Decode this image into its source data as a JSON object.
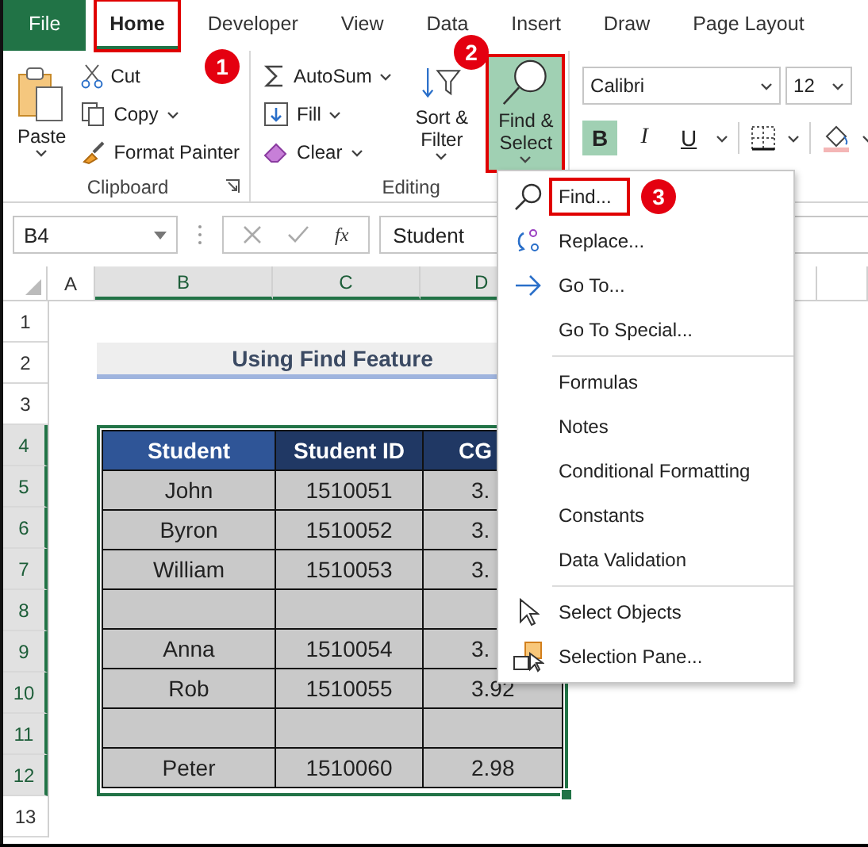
{
  "tabs": [
    {
      "label": "File",
      "kind": "file",
      "selected": false,
      "highlighted": false
    },
    {
      "label": "Home",
      "kind": "tab",
      "selected": true,
      "highlighted": true
    },
    {
      "label": "Developer",
      "kind": "tab",
      "selected": false,
      "highlighted": false
    },
    {
      "label": "View",
      "kind": "tab",
      "selected": false,
      "highlighted": false
    },
    {
      "label": "Data",
      "kind": "tab",
      "selected": false,
      "highlighted": false
    },
    {
      "label": "Insert",
      "kind": "tab",
      "selected": false,
      "highlighted": false
    },
    {
      "label": "Draw",
      "kind": "tab",
      "selected": false,
      "highlighted": false
    },
    {
      "label": "Page Layout",
      "kind": "tab",
      "selected": false,
      "highlighted": false
    }
  ],
  "ribbon": {
    "clipboard": {
      "label": "Clipboard",
      "paste": "Paste",
      "cut": "Cut",
      "copy": "Copy",
      "format_painter": "Format Painter"
    },
    "editing": {
      "label": "Editing",
      "autosum": "AutoSum",
      "fill": "Fill",
      "clear": "Clear",
      "sort_filter": "Sort & Filter",
      "find_select": {
        "label": "Find & Select",
        "selected": true,
        "highlighted": true
      }
    },
    "font": {
      "font_name": "Calibri",
      "font_size": "12",
      "bold": {
        "label": "B",
        "on": true
      },
      "italic": {
        "label": "I",
        "on": false
      },
      "underline": {
        "label": "U",
        "on": false
      }
    }
  },
  "formula_bar": {
    "name_box": "B4",
    "function_label": "fx",
    "value": "Student"
  },
  "sheet": {
    "columns": [
      {
        "label": "A",
        "selected": false
      },
      {
        "label": "B",
        "selected": true
      },
      {
        "label": "C",
        "selected": true
      },
      {
        "label": "D",
        "selected": true
      }
    ],
    "rows": [
      {
        "label": "1",
        "selected": false
      },
      {
        "label": "2",
        "selected": false
      },
      {
        "label": "3",
        "selected": false
      },
      {
        "label": "4",
        "selected": true
      },
      {
        "label": "5",
        "selected": true
      },
      {
        "label": "6",
        "selected": true
      },
      {
        "label": "7",
        "selected": true
      },
      {
        "label": "8",
        "selected": true
      },
      {
        "label": "9",
        "selected": true
      },
      {
        "label": "10",
        "selected": true
      },
      {
        "label": "11",
        "selected": true
      },
      {
        "label": "12",
        "selected": true
      },
      {
        "label": "13",
        "selected": false
      }
    ],
    "title": "Using Find Feature",
    "table": {
      "columns": [
        "Student",
        "Student ID",
        "CG"
      ],
      "rows": [
        {
          "kind": "data",
          "cells": [
            "John",
            "1510051",
            "3."
          ]
        },
        {
          "kind": "data",
          "cells": [
            "Byron",
            "1510052",
            "3."
          ]
        },
        {
          "kind": "data",
          "cells": [
            "William",
            "1510053",
            "3."
          ]
        },
        {
          "kind": "blank"
        },
        {
          "kind": "data",
          "cells": [
            "Anna",
            "1510054",
            "3."
          ]
        },
        {
          "kind": "data",
          "cells": [
            "Rob",
            "1510055",
            "3.92"
          ]
        },
        {
          "kind": "blank"
        },
        {
          "kind": "data",
          "cells": [
            "Peter",
            "1510060",
            "2.98"
          ]
        }
      ]
    }
  },
  "find_menu": {
    "sections": [
      [
        {
          "label": "Find...",
          "kind": "find",
          "highlighted": true
        },
        {
          "label": "Replace...",
          "kind": "replace",
          "highlighted": false
        },
        {
          "label": "Go To...",
          "kind": "goto",
          "highlighted": false
        },
        {
          "label": "Go To Special...",
          "kind": "plain",
          "highlighted": false
        }
      ],
      [
        {
          "label": "Formulas",
          "kind": "plain",
          "highlighted": false
        },
        {
          "label": "Notes",
          "kind": "plain",
          "highlighted": false
        },
        {
          "label": "Conditional Formatting",
          "kind": "plain",
          "highlighted": false
        },
        {
          "label": "Constants",
          "kind": "plain",
          "highlighted": false
        },
        {
          "label": "Data Validation",
          "kind": "plain",
          "highlighted": false
        }
      ],
      [
        {
          "label": "Select Objects",
          "kind": "select",
          "highlighted": false
        },
        {
          "label": "Selection Pane...",
          "kind": "pane",
          "highlighted": false
        }
      ]
    ]
  },
  "annotations": [
    {
      "label": "1"
    },
    {
      "label": "2"
    },
    {
      "label": "3"
    }
  ]
}
